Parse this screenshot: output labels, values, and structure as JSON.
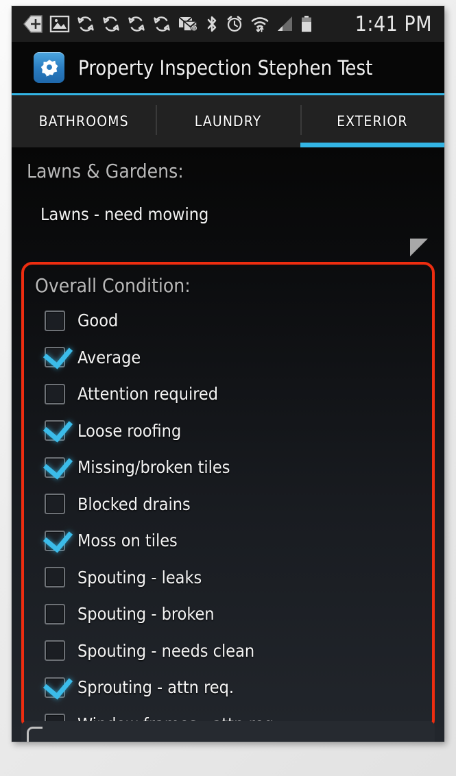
{
  "statusbar": {
    "time": "1:41 PM",
    "icons": [
      "back-add-icon",
      "image-icon",
      "sync-icon",
      "sync-icon",
      "sync-icon",
      "sync-icon",
      "email-icon",
      "bluetooth-icon",
      "alarm-icon",
      "wifi-icon",
      "signal-icon",
      "battery-icon"
    ]
  },
  "appbar": {
    "icon": "app-gear-icon",
    "title": "Property Inspection Stephen Test"
  },
  "tabs": [
    {
      "label": "BATHROOMS",
      "active": false
    },
    {
      "label": "LAUNDRY",
      "active": false
    },
    {
      "label": "EXTERIOR",
      "active": true
    }
  ],
  "lawns": {
    "title": "Lawns & Gardens:",
    "value": "Lawns - need mowing",
    "resize_handle": "resize-handle-icon"
  },
  "condition": {
    "title": "Overall Condition:",
    "items": [
      {
        "label": "Good",
        "checked": false
      },
      {
        "label": "Average",
        "checked": true
      },
      {
        "label": "Attention required",
        "checked": false
      },
      {
        "label": "Loose roofing",
        "checked": true
      },
      {
        "label": "Missing/broken tiles",
        "checked": true
      },
      {
        "label": "Blocked drains",
        "checked": false
      },
      {
        "label": "Moss on tiles",
        "checked": true
      },
      {
        "label": "Spouting - leaks",
        "checked": false
      },
      {
        "label": "Spouting - broken",
        "checked": false
      },
      {
        "label": "Spouting - needs clean",
        "checked": false
      },
      {
        "label": "Sprouting - attn req.",
        "checked": true
      },
      {
        "label": "Window frames - attn req.",
        "checked": false
      }
    ]
  },
  "colors": {
    "accent_blue": "#33b5e5",
    "highlight_red": "#ee2d10",
    "checkmark_blue": "#3bbcea",
    "status_bar_bg": "#1d1d1d",
    "tab_bg": "#222222"
  }
}
